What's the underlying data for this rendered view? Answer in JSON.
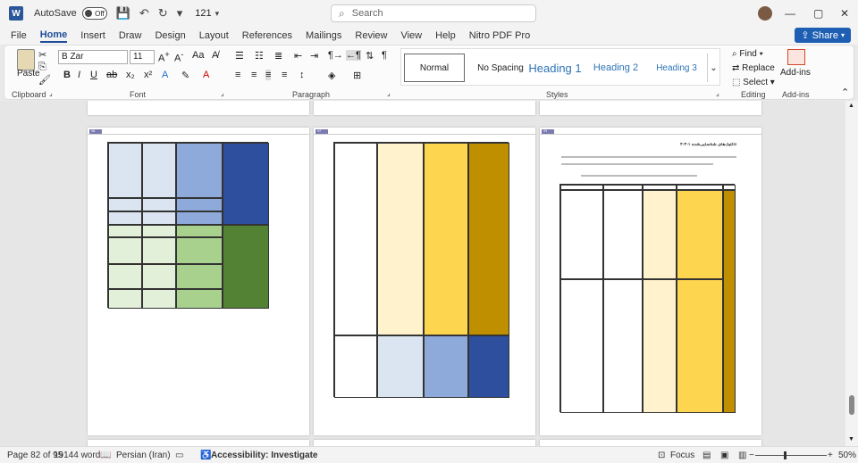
{
  "titlebar": {
    "autosave_label": "AutoSave",
    "autosave_state": "Off",
    "doc_name": "121",
    "search_placeholder": "Search"
  },
  "menu": {
    "items": [
      "File",
      "Home",
      "Insert",
      "Draw",
      "Design",
      "Layout",
      "References",
      "Mailings",
      "Review",
      "View",
      "Help",
      "Nitro PDF Pro"
    ],
    "active": "Home",
    "share_label": "Share"
  },
  "ribbon": {
    "clipboard": {
      "paste_label": "Paste",
      "group_label": "Clipboard"
    },
    "font": {
      "font_name": "B Zar",
      "font_size": "11",
      "group_label": "Font"
    },
    "paragraph": {
      "group_label": "Paragraph"
    },
    "styles": {
      "group_label": "Styles",
      "items": [
        "Normal",
        "No Spacing",
        "Heading 1",
        "Heading 2",
        "Heading 3"
      ]
    },
    "editing": {
      "find": "Find",
      "replace": "Replace",
      "select": "Select",
      "group_label": "Editing"
    },
    "addins": {
      "label": "Add-ins",
      "group_label": "Add-ins"
    }
  },
  "pages": {
    "left_number": "۷۵",
    "middle_number": "۷۶",
    "right_number": "۷۷",
    "right_heading": "۴-۳-۱ تاکتیک‌های شناسایی‌شده"
  },
  "status": {
    "page": "Page 82 of 95",
    "words": "19144 words",
    "language": "Persian (Iran)",
    "accessibility": "Accessibility: Investigate",
    "focus": "Focus",
    "zoom": "50%"
  },
  "colors": {
    "dark_blue": "#2e4f9e",
    "light_blue": "#8eaadb",
    "pale_blue": "#dbe5f1",
    "green": "#548235",
    "pale_green": "#e2efd9",
    "yellow": "#fdd54e",
    "pale_yellow": "#fff2cc",
    "gold": "#bf8f00",
    "word_blue": "#2b579a"
  }
}
